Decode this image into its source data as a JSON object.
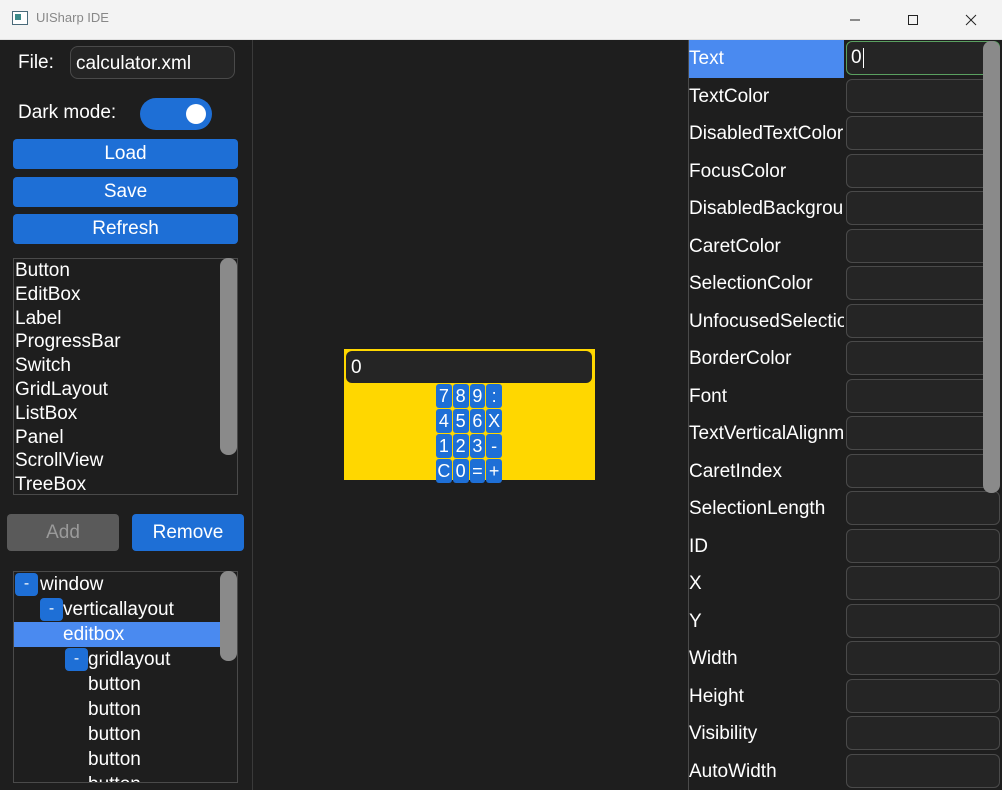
{
  "window": {
    "title": "UISharp IDE"
  },
  "left": {
    "file_label": "File:",
    "file_value": "calculator.xml",
    "dark_mode_label": "Dark mode:",
    "dark_mode_on": true,
    "load_label": "Load",
    "save_label": "Save",
    "refresh_label": "Refresh",
    "widgets": [
      "Button",
      "EditBox",
      "Label",
      "ProgressBar",
      "Switch",
      "GridLayout",
      "ListBox",
      "Panel",
      "ScrollView",
      "TreeBox"
    ],
    "add_label": "Add",
    "remove_label": "Remove",
    "tree": [
      {
        "label": "window",
        "toggle": "-"
      },
      {
        "label": "verticallayout",
        "toggle": "-"
      },
      {
        "label": "editbox",
        "toggle": ""
      },
      {
        "label": "gridlayout",
        "toggle": "-"
      },
      {
        "label": "button",
        "toggle": ""
      },
      {
        "label": "button",
        "toggle": ""
      },
      {
        "label": "button",
        "toggle": ""
      },
      {
        "label": "button",
        "toggle": ""
      },
      {
        "label": "button",
        "toggle": ""
      }
    ]
  },
  "preview": {
    "display_value": "0",
    "buttons": [
      "7",
      "8",
      "9",
      ":",
      "4",
      "5",
      "6",
      "X",
      "1",
      "2",
      "3",
      "-",
      "C",
      "0",
      "=",
      "+"
    ]
  },
  "properties": {
    "items": [
      {
        "name": "Text",
        "value": "0"
      },
      {
        "name": "TextColor",
        "value": ""
      },
      {
        "name": "DisabledTextColor",
        "value": ""
      },
      {
        "name": "FocusColor",
        "value": ""
      },
      {
        "name": "DisabledBackground",
        "value": ""
      },
      {
        "name": "CaretColor",
        "value": ""
      },
      {
        "name": "SelectionColor",
        "value": ""
      },
      {
        "name": "UnfocusedSelectionColor",
        "value": ""
      },
      {
        "name": "BorderColor",
        "value": ""
      },
      {
        "name": "Font",
        "value": ""
      },
      {
        "name": "TextVerticalAlignment",
        "value": ""
      },
      {
        "name": "CaretIndex",
        "value": ""
      },
      {
        "name": "SelectionLength",
        "value": ""
      },
      {
        "name": "ID",
        "value": ""
      },
      {
        "name": "X",
        "value": ""
      },
      {
        "name": "Y",
        "value": ""
      },
      {
        "name": "Width",
        "value": ""
      },
      {
        "name": "Height",
        "value": ""
      },
      {
        "name": "Visibility",
        "value": ""
      },
      {
        "name": "AutoWidth",
        "value": ""
      }
    ]
  },
  "colors": {
    "accent": "#1e6fd6",
    "selection": "#4a8af0",
    "preview_bg": "#ffd700",
    "background": "#1e1e1e"
  }
}
